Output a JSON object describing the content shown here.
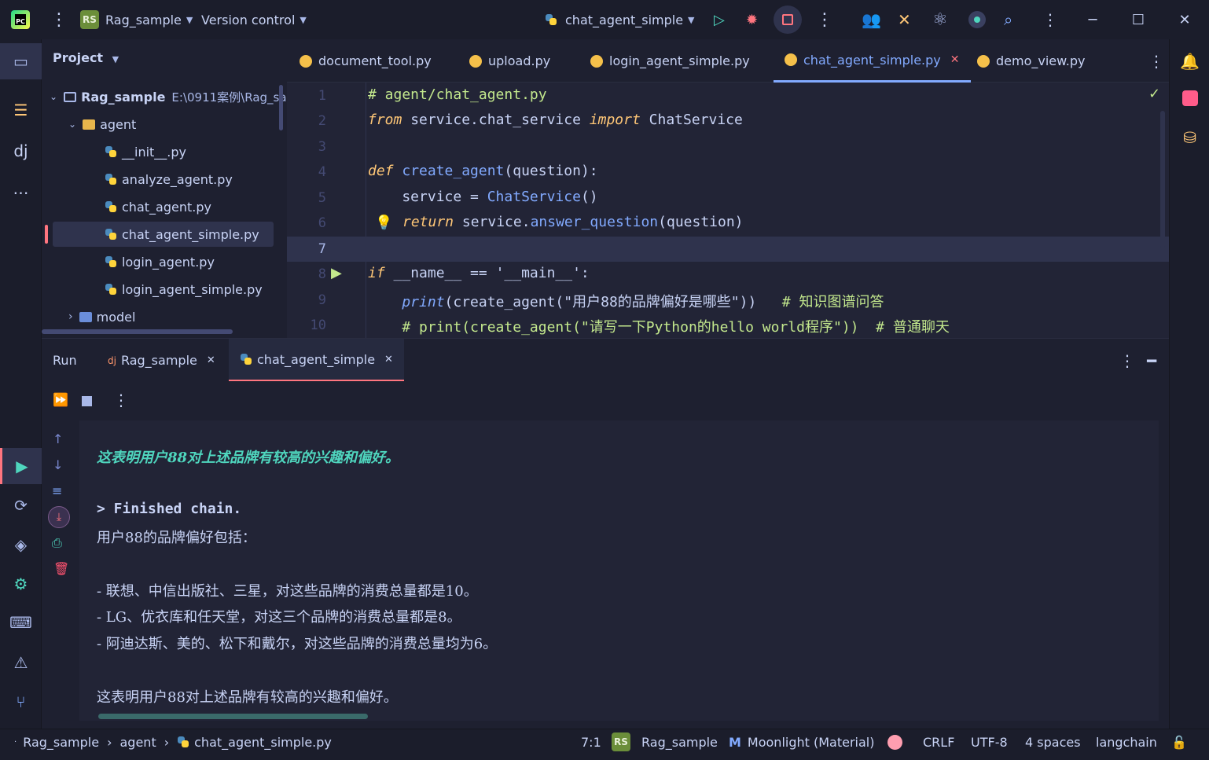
{
  "titlebar": {
    "project_badge": "RS",
    "project_name": "Rag_sample",
    "vcs_label": "Version control",
    "run_config": "chat_agent_simple"
  },
  "project_panel": {
    "title": "Project",
    "root_name": "Rag_sample",
    "root_path": "E:\\0911案例\\Rag_sa",
    "folder_agent": "agent",
    "files": [
      "__init__.py",
      "analyze_agent.py",
      "chat_agent.py",
      "chat_agent_simple.py",
      "login_agent.py",
      "login_agent_simple.py"
    ],
    "folder_model": "model"
  },
  "editor_tabs": [
    "document_tool.py",
    "upload.py",
    "login_agent_simple.py",
    "chat_agent_simple.py",
    "demo_view.py"
  ],
  "editor": {
    "line_numbers": [
      "1",
      "2",
      "3",
      "4",
      "5",
      "6",
      "7",
      "8",
      "9",
      "10"
    ],
    "lines": {
      "l1": "# agent/chat_agent.py",
      "l2_kw1": "from",
      "l2_mod": " service.chat_service ",
      "l2_kw2": "import",
      "l2_cls": " ChatService",
      "l4_kw": "def",
      "l4_fn": " create_agent",
      "l4_rest": "(question):",
      "l5_a": "    service = ",
      "l5_b": "ChatService",
      "l5_c": "()",
      "l6_kw": "return",
      "l6_a": " service.",
      "l6_b": "answer_question",
      "l6_c": "(question)",
      "l8_kw": "if",
      "l8_rest": " __name__ == '__main__':",
      "l9_kw": "    print",
      "l9_a": "(create_agent(",
      "l9_str": "\"用户88的品牌偏好是哪些\"",
      "l9_b": "))",
      "l9_cm": "   # 知识图谱问答",
      "l10": "    # print(create_agent(\"请写一下Python的hello world程序\"))  # 普通聊天"
    }
  },
  "run_panel": {
    "label": "Run",
    "tabs": [
      "Rag_sample",
      "chat_agent_simple"
    ]
  },
  "console": {
    "line1": "这表明用户88对上述品牌有较高的兴趣和偏好。",
    "line2": "> Finished chain.",
    "line3": "用户88的品牌偏好包括：",
    "line4": "- 联想、中信出版社、三星，对这些品牌的消费总量都是10。",
    "line5": "- LG、优衣库和任天堂，对这三个品牌的消费总量都是8。",
    "line6": "- 阿迪达斯、美的、松下和戴尔，对这些品牌的消费总量均为6。",
    "line7": "这表明用户88对上述品牌有较高的兴趣和偏好。"
  },
  "statusbar": {
    "crumbs": [
      "Rag_sample",
      "agent",
      "chat_agent_simple.py"
    ],
    "position": "7:1",
    "badge": "RS",
    "project": "Rag_sample",
    "theme": "Moonlight (Material)",
    "line_sep": "CRLF",
    "encoding": "UTF-8",
    "indent": "4 spaces",
    "interpreter": "langchain"
  },
  "colors": {
    "accent": "#82aaff",
    "run_active": "#ff757f",
    "console_green": "#4fd6be"
  }
}
